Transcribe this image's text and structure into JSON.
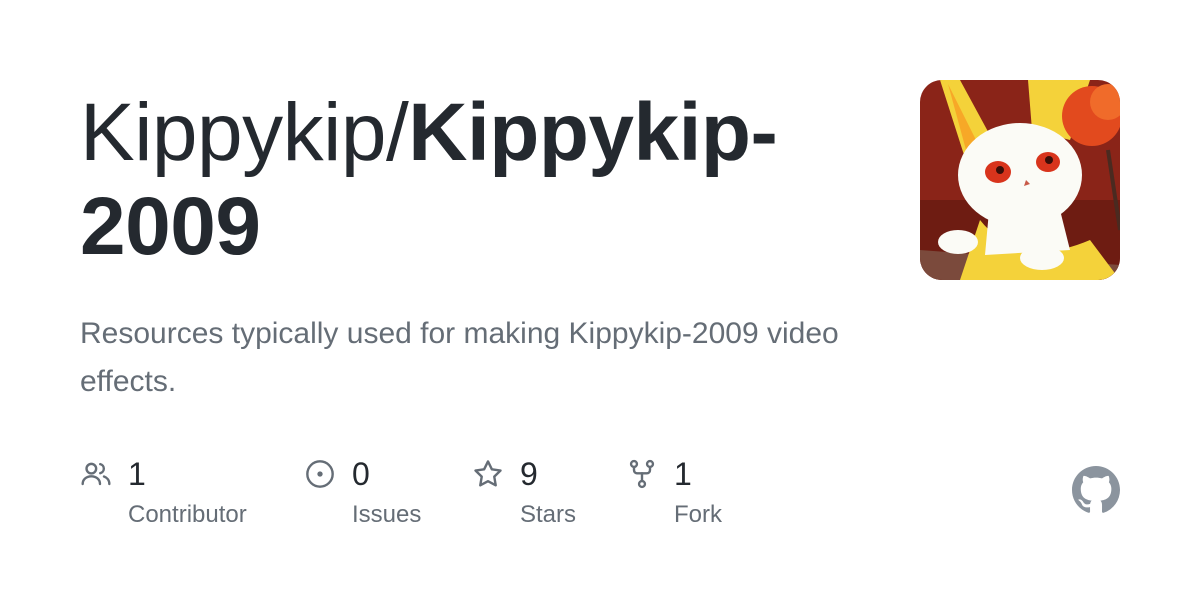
{
  "repo": {
    "owner": "Kippykip/",
    "name": "Kippykip-2009",
    "description": "Resources typically used for making Kippykip-2009 video effects."
  },
  "stats": [
    {
      "value": "1",
      "label": "Contributor",
      "icon": "people-icon"
    },
    {
      "value": "0",
      "label": "Issues",
      "icon": "issue-opened-icon"
    },
    {
      "value": "9",
      "label": "Stars",
      "icon": "star-icon"
    },
    {
      "value": "1",
      "label": "Fork",
      "icon": "repo-forked-icon"
    }
  ],
  "colors": {
    "title": "#24292f",
    "muted": "#656d76",
    "icon": "#656d76",
    "github_mark": "#8b949e"
  },
  "avatar": {
    "icon": "avatar-image"
  },
  "brand": {
    "icon": "github-mark-icon"
  }
}
